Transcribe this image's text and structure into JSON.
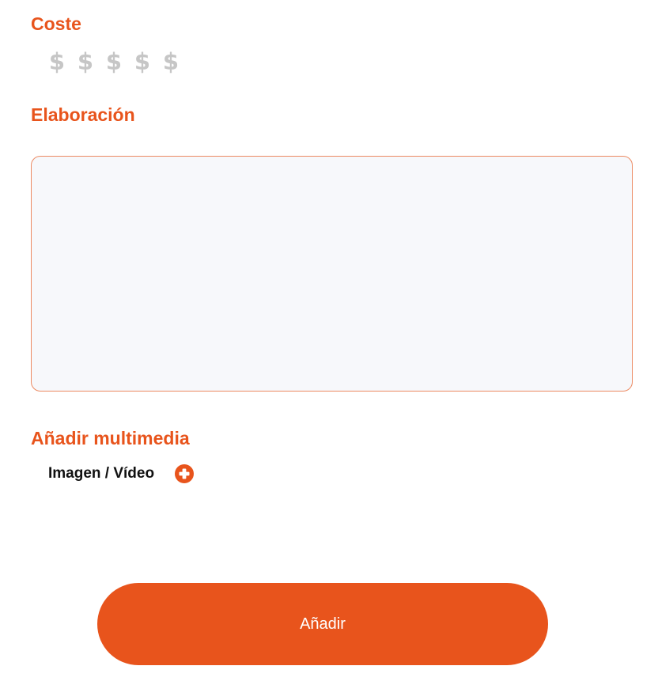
{
  "colors": {
    "accent": "#e8541c",
    "cost_inactive": "#c6c6c6",
    "textarea_bg": "#f7f8fb",
    "textarea_border": "#ec8a62"
  },
  "cost": {
    "title": "Coste",
    "symbol": "$",
    "symbols": [
      "$",
      "$",
      "$",
      "$",
      "$"
    ],
    "selected": 0,
    "max": 5
  },
  "elaboration": {
    "title": "Elaboración",
    "value": "",
    "placeholder": ""
  },
  "multimedia": {
    "title": "Añadir multimedia",
    "label": "Imagen / Vídeo",
    "add_icon": "plus-circle-icon"
  },
  "submit": {
    "label": "Añadir"
  }
}
